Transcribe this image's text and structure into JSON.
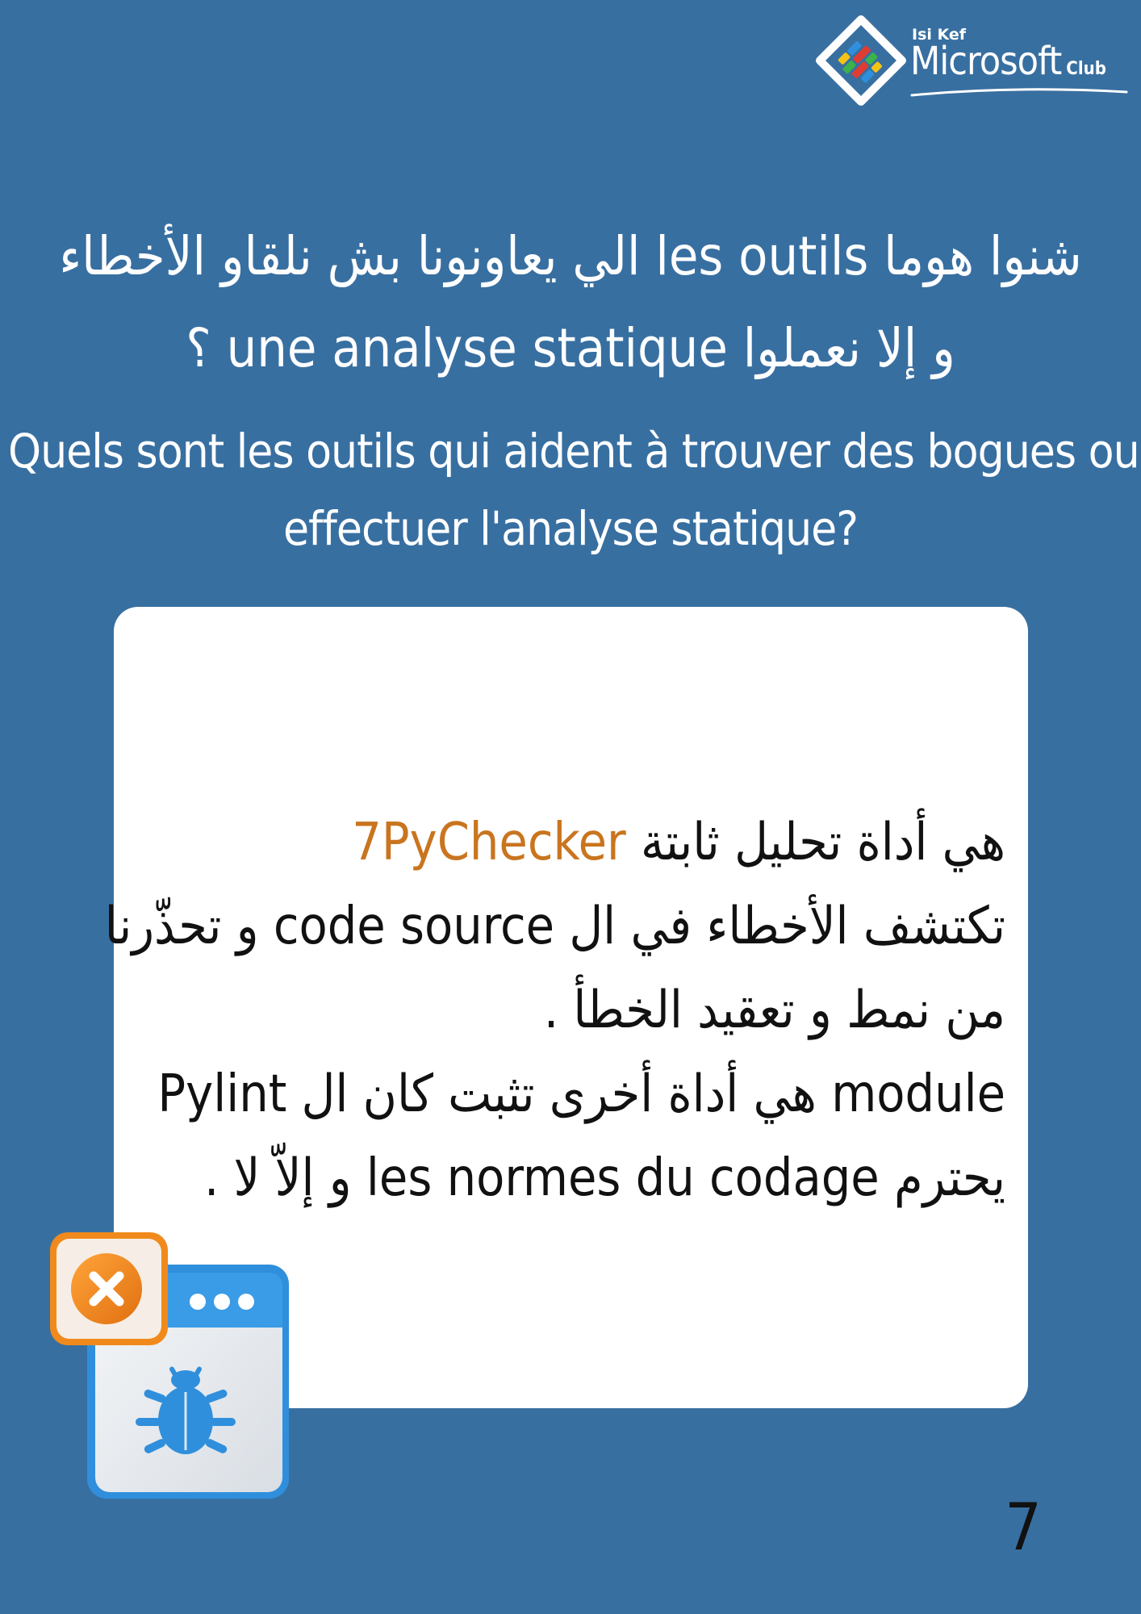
{
  "brand": {
    "small": "Isi Kef",
    "main": "Microsoft",
    "club": "Club"
  },
  "heading": {
    "ar_line1": "شنوا هوما les outils الي يعاونونا بش نلقاو الأخطاء",
    "ar_line2": "و إلا نعملوا une analyse statique ؟",
    "fr_line1": "Quels sont les outils qui aident à trouver des bogues ou à",
    "fr_line2": "effectuer l'analyse statique?"
  },
  "card": {
    "line1_highlight": "7PyChecker",
    "line1_rest": " هي أداة تحليل ثابتة",
    "line2": "تكتشف الأخطاء في ال code source  و تحذّرنا",
    "line3": "من نمط و تعقيد الخطأ .",
    "line4": "Pylint هي أداة أخرى تثبت كان ال module",
    "line5": "يحترم les normes du codage و إلاّ لا ."
  },
  "page_number": "7",
  "colors": {
    "background": "#386fa1",
    "card": "#ffffff",
    "highlight": "#c9751f",
    "icon_orange": "#f08a1c",
    "icon_blue": "#2f8fdc"
  },
  "icons": {
    "logo": "microsoft-club-diamond-logo",
    "illustration": "bug-window-error-icon",
    "error": "close-icon",
    "bug": "bug-icon"
  }
}
